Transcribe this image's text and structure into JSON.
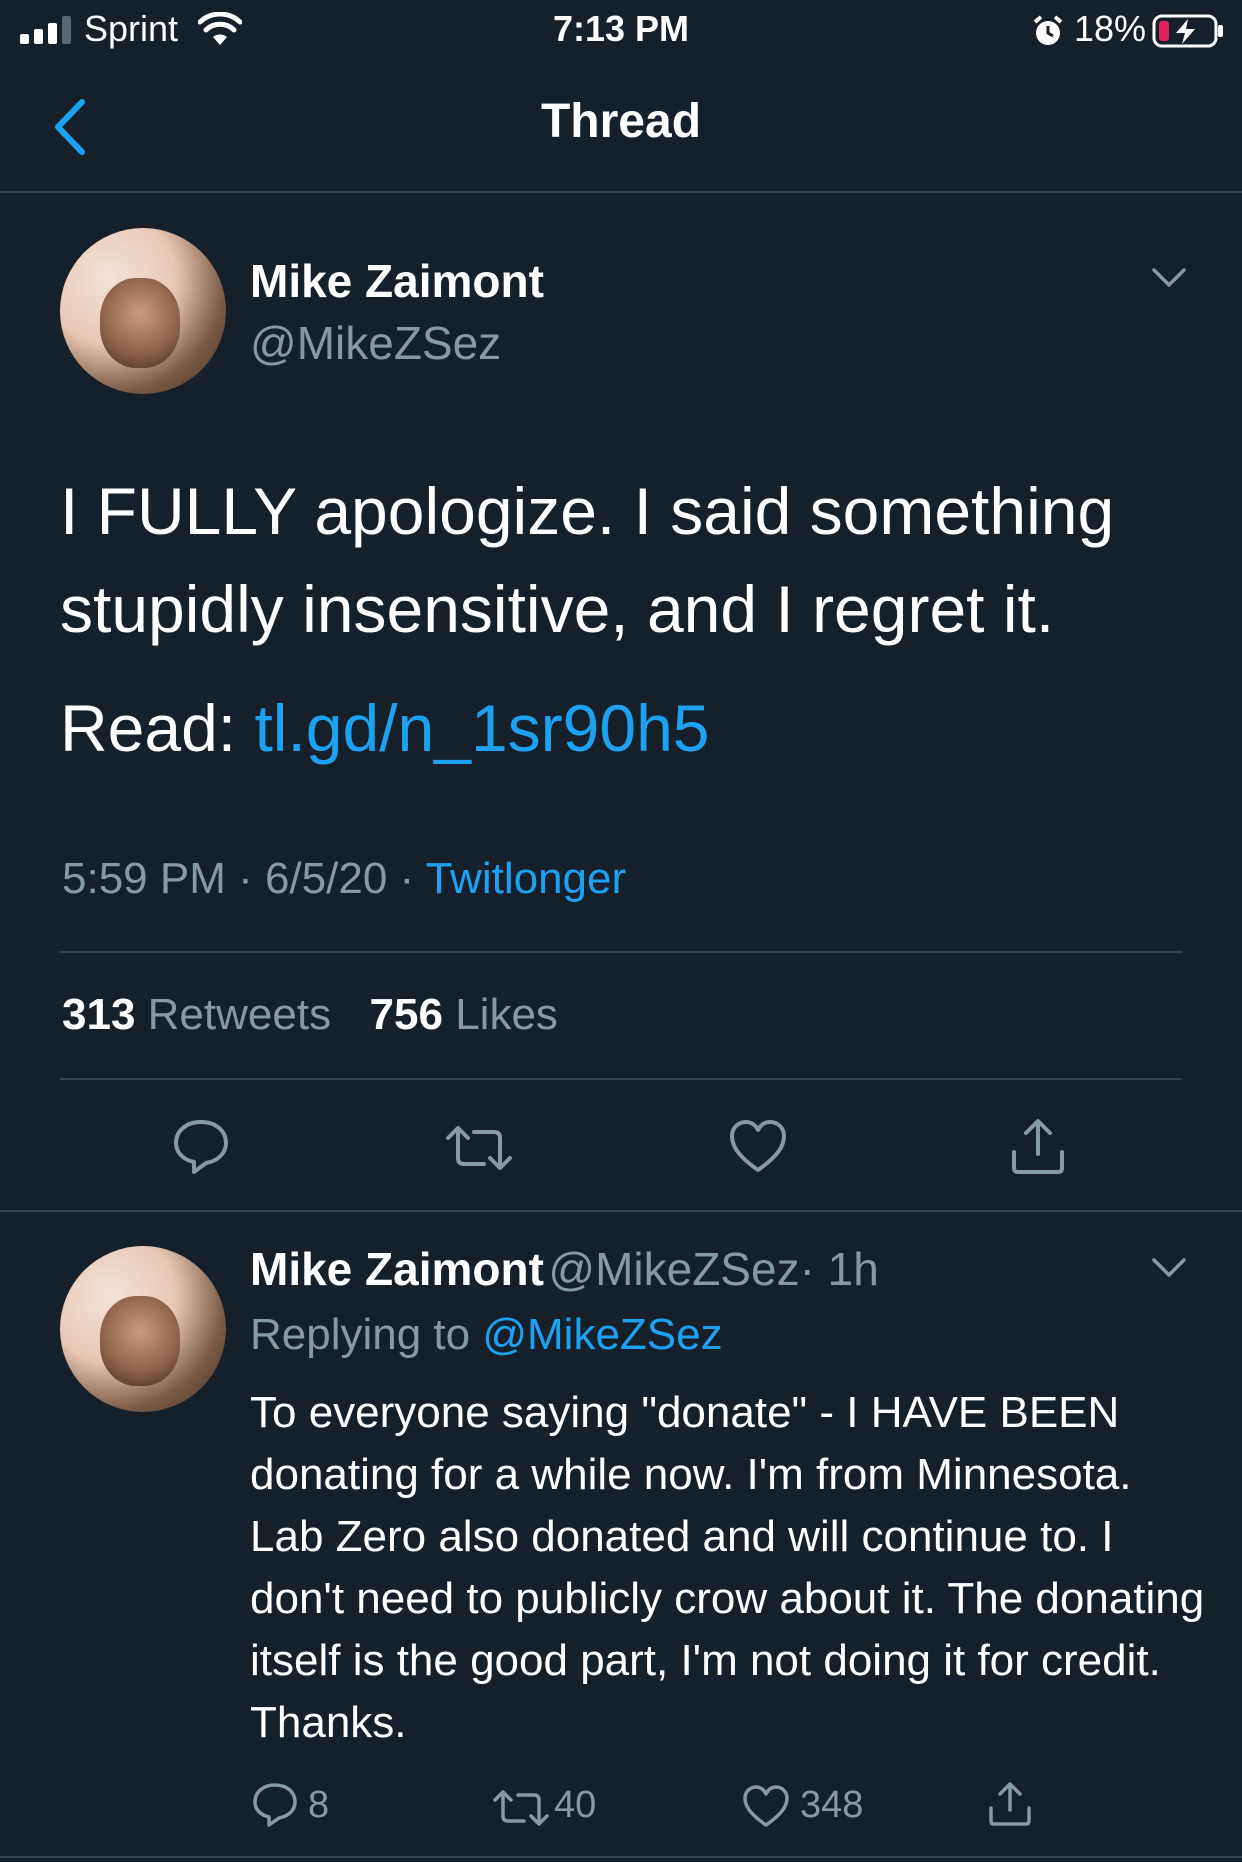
{
  "status_bar": {
    "carrier": "Sprint",
    "time": "7:13 PM",
    "battery_percent": "18%"
  },
  "header": {
    "title": "Thread"
  },
  "main_tweet": {
    "author_name": "Mike Zaimont",
    "author_handle": "@MikeZSez",
    "text": "I FULLY apologize.  I said something stupidly insensitive, and I regret it.",
    "read_label": "Read: ",
    "read_link": "tl.gd/n_1sr90h5",
    "timestamp": "5:59 PM · 6/5/20 · ",
    "source": "Twitlonger",
    "retweet_count": "313",
    "retweet_label": "Retweets",
    "like_count": "756",
    "like_label": "Likes"
  },
  "reply_tweet": {
    "author_name": "Mike Zaimont",
    "author_handle": "@MikeZSez",
    "time_ago": "· 1h",
    "replying_label": "Replying to ",
    "replying_handle": "@MikeZSez",
    "text": "To everyone saying \"donate\" - I HAVE BEEN donating for a while now.  I'm from Minnesota.  Lab Zero also donated and will continue to.  I don't need to publicly crow about it.  The donating itself is the good part, I'm not doing it for credit.  Thanks.",
    "reply_count": "8",
    "retweet_count": "40",
    "like_count": "348"
  },
  "colors": {
    "background": "#15202b",
    "accent": "#1da1f2",
    "muted": "#8899a6",
    "divider": "#38444d",
    "battery_low": "#e0245e"
  },
  "icons": {
    "signal": "cellular-signal-icon",
    "wifi": "wifi-icon",
    "alarm": "alarm-icon",
    "battery": "battery-charging-icon",
    "back": "chevron-left-icon",
    "more": "chevron-down-icon",
    "reply": "reply-icon",
    "retweet": "retweet-icon",
    "like": "heart-icon",
    "share": "share-icon"
  }
}
